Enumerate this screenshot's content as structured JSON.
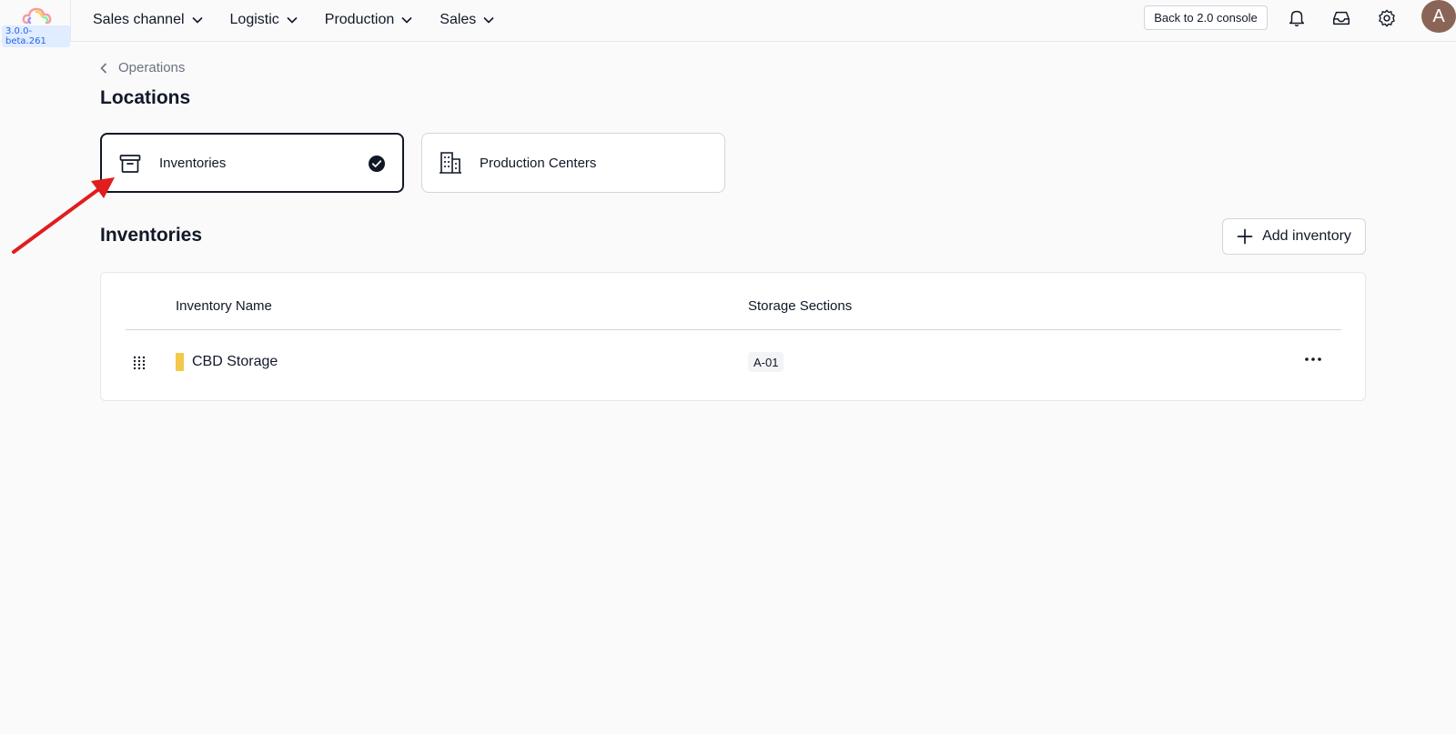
{
  "app": {
    "version": "3.0.0-beta.261",
    "nav": [
      {
        "label": "Sales channel"
      },
      {
        "label": "Logistic"
      },
      {
        "label": "Production"
      },
      {
        "label": "Sales"
      }
    ],
    "console_button": "Back to 2.0 console",
    "avatar_initial": "A",
    "icons": [
      "bell-icon",
      "inbox-icon",
      "gear-icon"
    ]
  },
  "page": {
    "breadcrumb": "Operations",
    "title": "Locations"
  },
  "location_tabs": [
    {
      "label": "Inventories",
      "icon": "archive-box-icon",
      "selected": true
    },
    {
      "label": "Production Centers",
      "icon": "building-icon",
      "selected": false
    }
  ],
  "inventories": {
    "title": "Inventories",
    "add_button": "Add inventory",
    "columns": [
      "Inventory Name",
      "Storage Sections"
    ],
    "rows": [
      {
        "name": "CBD Storage",
        "color": "#f2c94c",
        "sections": [
          "A-01"
        ]
      }
    ]
  },
  "colors": {
    "accent": "#111827",
    "version_badge": "#2563eb",
    "avatar_bg": "#8a6557",
    "annotation_arrow": "#e11d1d"
  }
}
